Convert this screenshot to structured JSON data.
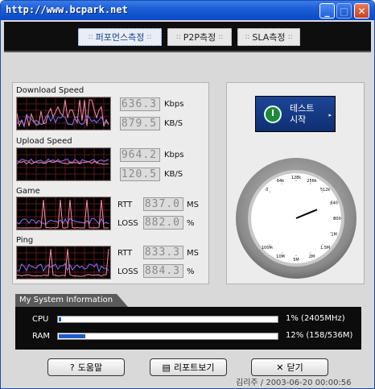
{
  "window": {
    "title": "http://www.bcpark.net",
    "minimize_label": "_",
    "maximize_label": "□",
    "close_label": "✕"
  },
  "tabs": [
    {
      "label": "퍼포먼스측정",
      "active": true
    },
    {
      "label": "P2P측정",
      "active": false
    },
    {
      "label": "SLA측정",
      "active": false
    }
  ],
  "meters": {
    "download": {
      "label": "Download Speed",
      "value1": "636.3",
      "unit1": "Kbps",
      "value2": "879.5",
      "unit2": "KB/S"
    },
    "upload": {
      "label": "Upload Speed",
      "value1": "964.2",
      "unit1": "Kbps",
      "value2": "120.5",
      "unit2": "KB/S"
    },
    "game": {
      "label": "Game",
      "rtt_label": "RTT",
      "rtt_value": "837.0",
      "rtt_unit": "MS",
      "loss_label": "LOSS",
      "loss_value": "882.0",
      "loss_unit": "%"
    },
    "ping": {
      "label": "Ping",
      "rtt_label": "RTT",
      "rtt_value": "833.3",
      "rtt_unit": "MS",
      "loss_label": "LOSS",
      "loss_value": "884.3",
      "loss_unit": "%"
    }
  },
  "test_button": {
    "line1": "테스트",
    "line2": "시작",
    "arrow": "▸"
  },
  "gauge": {
    "tick_labels": [
      "0",
      "64k",
      "128k",
      "256k",
      "512k",
      "640",
      "800",
      "1M",
      "1.5M",
      "2M",
      "5M",
      "10M",
      "100M"
    ],
    "needle_value": "640"
  },
  "system": {
    "title": "My System Information",
    "cpu": {
      "label": "CPU",
      "percent": 1,
      "value": "1% (2405MHz)"
    },
    "ram": {
      "label": "RAM",
      "percent": 12,
      "value": "12% (158/536M)"
    }
  },
  "buttons": {
    "help": "도움말",
    "report": "리포트보기",
    "close": "닫기"
  },
  "footer": "김리주 / 2003-06-20 00:00:56",
  "colors": {
    "graph_bg": "#000000",
    "graph_grid": "#5a1a1a",
    "series_blue": "#7a7aff",
    "series_pink": "#ff8aa8",
    "accent_blue": "#1d4596"
  }
}
